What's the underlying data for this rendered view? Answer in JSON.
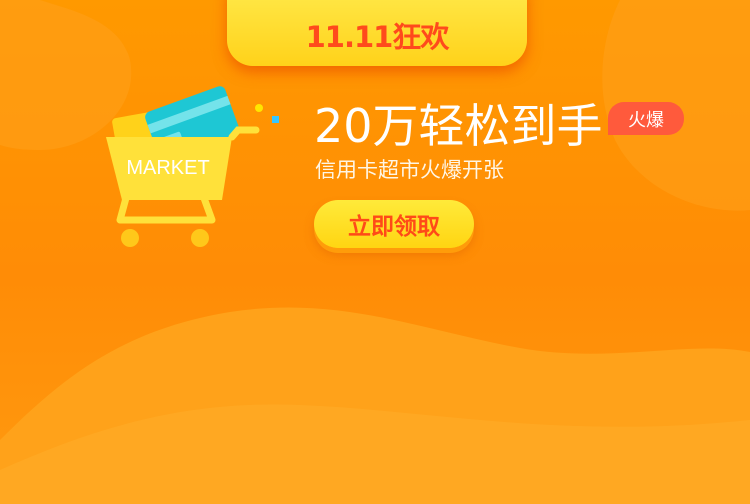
{
  "promo": {
    "tab_label": "11.11狂欢",
    "title": "20万轻松到手",
    "hot_badge": "火爆",
    "subtitle": "信用卡超市火爆开张",
    "cta_label": "立即领取"
  },
  "cart": {
    "label": "MARKET",
    "icon": "shopping-cart-icon"
  },
  "colors": {
    "background": "#ff9900",
    "tab": "#ffe03a",
    "tab_text": "#ff4a1c",
    "badge": "#ff5a3c",
    "cta": "#ffdf26",
    "cta_text": "#ff4a18",
    "card": "#1ec7d4"
  }
}
